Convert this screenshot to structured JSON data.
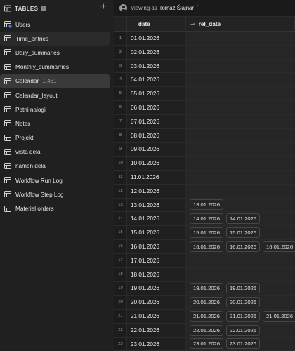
{
  "sidebar": {
    "title": "TABLES",
    "info_glyph": "i",
    "add_glyph": "+",
    "items": [
      {
        "label": "Users",
        "count": "",
        "icon": "users-table-icon"
      },
      {
        "label": "Time_entries",
        "count": "",
        "icon": "table-icon"
      },
      {
        "label": "Daily_summaries",
        "count": "",
        "icon": "table-icon"
      },
      {
        "label": "Monthly_summarries",
        "count": "",
        "icon": "table-icon"
      },
      {
        "label": "Calendar",
        "count": "1.461",
        "icon": "table-icon"
      },
      {
        "label": "Calendar_layout",
        "count": "",
        "icon": "table-icon"
      },
      {
        "label": "Potni nalogi",
        "count": "",
        "icon": "table-icon"
      },
      {
        "label": "Notes",
        "count": "",
        "icon": "table-icon"
      },
      {
        "label": "Projekti",
        "count": "",
        "icon": "table-icon"
      },
      {
        "label": "vrsta dela",
        "count": "",
        "icon": "table-icon"
      },
      {
        "label": "namen dela",
        "count": "",
        "icon": "table-icon"
      },
      {
        "label": "Workflow Run Log",
        "count": "",
        "icon": "table-icon"
      },
      {
        "label": "Workflow Step Log",
        "count": "",
        "icon": "table-icon"
      },
      {
        "label": "Material orders",
        "count": "",
        "icon": "table-icon"
      }
    ]
  },
  "topbar": {
    "viewing_prefix": "Viewing as",
    "user": "Tomaž Šlajnar",
    "chevron": "⌃"
  },
  "grid": {
    "columns": [
      {
        "label": "date",
        "type_glyph": "T"
      },
      {
        "label": "rel_date",
        "type_glyph": "⇀"
      }
    ],
    "rows": [
      {
        "n": "1",
        "date": "01.01.2026",
        "rel": []
      },
      {
        "n": "2",
        "date": "02.01.2026",
        "rel": []
      },
      {
        "n": "3",
        "date": "03.01.2026",
        "rel": []
      },
      {
        "n": "4",
        "date": "04.01.2026",
        "rel": []
      },
      {
        "n": "5",
        "date": "05.01.2026",
        "rel": []
      },
      {
        "n": "6",
        "date": "06.01.2026",
        "rel": []
      },
      {
        "n": "7",
        "date": "07.01.2026",
        "rel": []
      },
      {
        "n": "8",
        "date": "08.01.2026",
        "rel": []
      },
      {
        "n": "9",
        "date": "09.01.2026",
        "rel": []
      },
      {
        "n": "10",
        "date": "10.01.2026",
        "rel": []
      },
      {
        "n": "11",
        "date": "11.01.2026",
        "rel": []
      },
      {
        "n": "12",
        "date": "12.01.2026",
        "rel": []
      },
      {
        "n": "13",
        "date": "13.01.2026",
        "rel": [
          "13.01.2026"
        ]
      },
      {
        "n": "14",
        "date": "14.01.2026",
        "rel": [
          "14.01.2026",
          "14.01.2026"
        ]
      },
      {
        "n": "15",
        "date": "15.01.2026",
        "rel": [
          "15.01.2026",
          "15.01.2026"
        ]
      },
      {
        "n": "16",
        "date": "16.01.2026",
        "rel": [
          "16.01.2026",
          "16.01.2026",
          "16.01.2026"
        ]
      },
      {
        "n": "17",
        "date": "17.01.2026",
        "rel": []
      },
      {
        "n": "18",
        "date": "18.01.2026",
        "rel": []
      },
      {
        "n": "19",
        "date": "19.01.2026",
        "rel": [
          "19.01.2026",
          "19.01.2026"
        ]
      },
      {
        "n": "20",
        "date": "20.01.2026",
        "rel": [
          "20.01.2026",
          "20.01.2026"
        ]
      },
      {
        "n": "21",
        "date": "21.01.2026",
        "rel": [
          "21.01.2026",
          "21.01.2026",
          "21.01.2026"
        ]
      },
      {
        "n": "22",
        "date": "22.01.2026",
        "rel": [
          "22.01.2026",
          "22.01.2026"
        ]
      },
      {
        "n": "23",
        "date": "23.01.2026",
        "rel": [
          "23.01.2026",
          "23.01.2026"
        ]
      }
    ]
  },
  "colors": {
    "selected_item_bg": "#3a3a3a",
    "chip_border": "#474747"
  }
}
